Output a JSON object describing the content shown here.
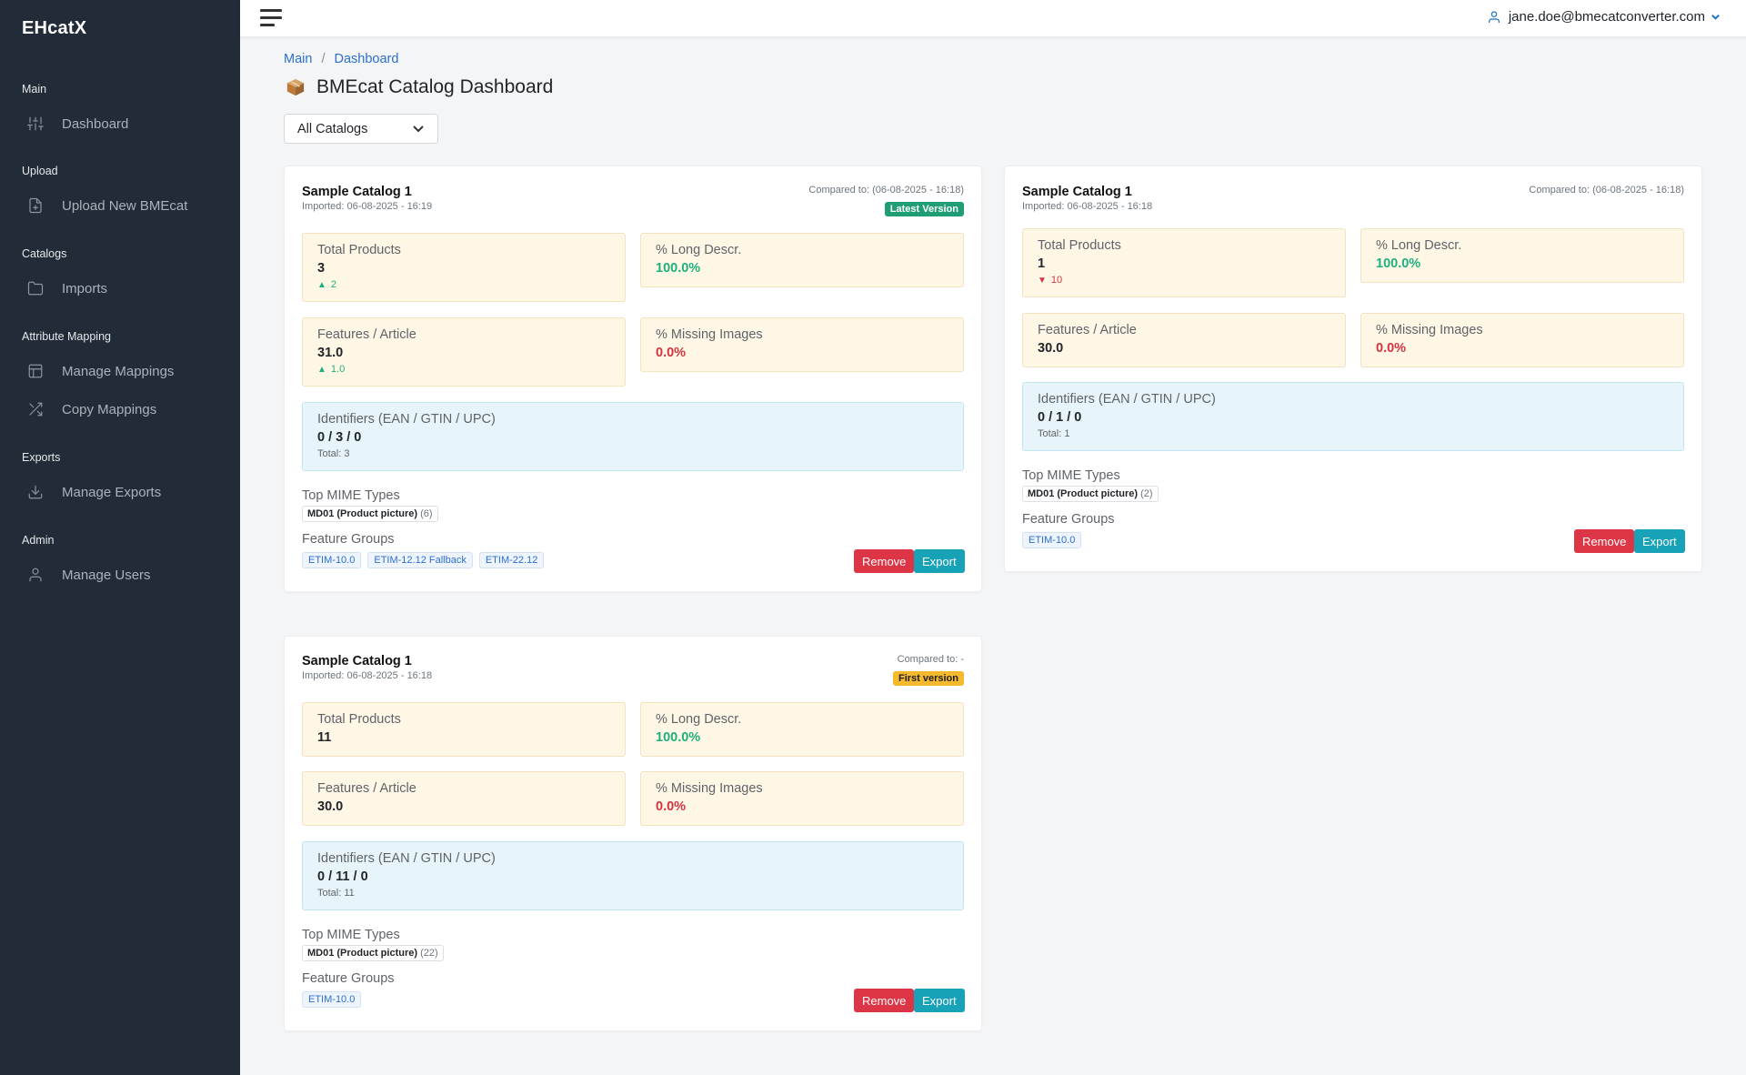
{
  "brand": "EHcatX",
  "sidebar": {
    "sections": [
      {
        "title": "Main",
        "items": [
          {
            "label": "Dashboard",
            "icon": "sliders-icon"
          }
        ]
      },
      {
        "title": "Upload",
        "items": [
          {
            "label": "Upload New BMEcat",
            "icon": "file-plus-icon"
          }
        ]
      },
      {
        "title": "Catalogs",
        "items": [
          {
            "label": "Imports",
            "icon": "folder-icon"
          }
        ]
      },
      {
        "title": "Attribute Mapping",
        "items": [
          {
            "label": "Manage Mappings",
            "icon": "table-icon"
          },
          {
            "label": "Copy Mappings",
            "icon": "shuffle-icon"
          }
        ]
      },
      {
        "title": "Exports",
        "items": [
          {
            "label": "Manage Exports",
            "icon": "download-icon"
          }
        ]
      },
      {
        "title": "Admin",
        "items": [
          {
            "label": "Manage Users",
            "icon": "user-icon"
          }
        ]
      }
    ]
  },
  "topbar": {
    "user_email": "jane.doe@bmecatconverter.com"
  },
  "breadcrumb": {
    "main": "Main",
    "separator": "/",
    "current": "Dashboard"
  },
  "page_title": "BMEcat Catalog Dashboard",
  "filter": {
    "selected": "All Catalogs"
  },
  "cards": [
    {
      "title": "Sample Catalog 1",
      "imported": "Imported: 06-08-2025 - 16:19",
      "compared": "Compared to: (06-08-2025 - 16:18)",
      "badge": "Latest Version",
      "total_products": {
        "label": "Total Products",
        "value": "3",
        "delta": "2",
        "delta_dir": "up"
      },
      "long_descr": {
        "label": "% Long Descr.",
        "value": "100.0%"
      },
      "features": {
        "label": "Features / Article",
        "value": "31.0",
        "delta": "1.0",
        "delta_dir": "up"
      },
      "missing_images": {
        "label": "% Missing Images",
        "value": "0.0%"
      },
      "identifiers": {
        "label": "Identifiers (EAN / GTIN / UPC)",
        "value": "0 / 3 / 0",
        "total": "Total: 3"
      },
      "mime_label": "Top MIME Types",
      "mime": {
        "name": "MD01 (Product picture)",
        "count": "(6)"
      },
      "fg_label": "Feature Groups",
      "feature_groups": [
        "ETIM-10.0",
        "ETIM-12.12 Fallback",
        "ETIM-22.12"
      ],
      "remove": "Remove",
      "export": "Export"
    },
    {
      "title": "Sample Catalog 1",
      "imported": "Imported: 06-08-2025 - 16:18",
      "compared": "Compared to: (06-08-2025 - 16:18)",
      "total_products": {
        "label": "Total Products",
        "value": "1",
        "delta": "10",
        "delta_dir": "down"
      },
      "long_descr": {
        "label": "% Long Descr.",
        "value": "100.0%"
      },
      "features": {
        "label": "Features / Article",
        "value": "30.0"
      },
      "missing_images": {
        "label": "% Missing Images",
        "value": "0.0%"
      },
      "identifiers": {
        "label": "Identifiers (EAN / GTIN / UPC)",
        "value": "0 / 1 / 0",
        "total": "Total: 1"
      },
      "mime_label": "Top MIME Types",
      "mime": {
        "name": "MD01 (Product picture)",
        "count": "(2)"
      },
      "fg_label": "Feature Groups",
      "feature_groups": [
        "ETIM-10.0"
      ],
      "remove": "Remove",
      "export": "Export"
    },
    {
      "title": "Sample Catalog 1",
      "imported": "Imported: 06-08-2025 - 16:18",
      "compared": "Compared to: -",
      "badge": "First version",
      "total_products": {
        "label": "Total Products",
        "value": "11"
      },
      "long_descr": {
        "label": "% Long Descr.",
        "value": "100.0%"
      },
      "features": {
        "label": "Features / Article",
        "value": "30.0"
      },
      "missing_images": {
        "label": "% Missing Images",
        "value": "0.0%"
      },
      "identifiers": {
        "label": "Identifiers (EAN / GTIN / UPC)",
        "value": "0 / 11 / 0",
        "total": "Total: 11"
      },
      "mime_label": "Top MIME Types",
      "mime": {
        "name": "MD01 (Product picture)",
        "count": "(22)"
      },
      "fg_label": "Feature Groups",
      "feature_groups": [
        "ETIM-10.0"
      ],
      "remove": "Remove",
      "export": "Export"
    }
  ],
  "colors": {
    "sidebar": "#222b38",
    "accent": "#2c6fd1",
    "positive": "#1fae7d",
    "negative": "#d4333f",
    "remove": "#dc3545",
    "export": "#17a2b8"
  }
}
